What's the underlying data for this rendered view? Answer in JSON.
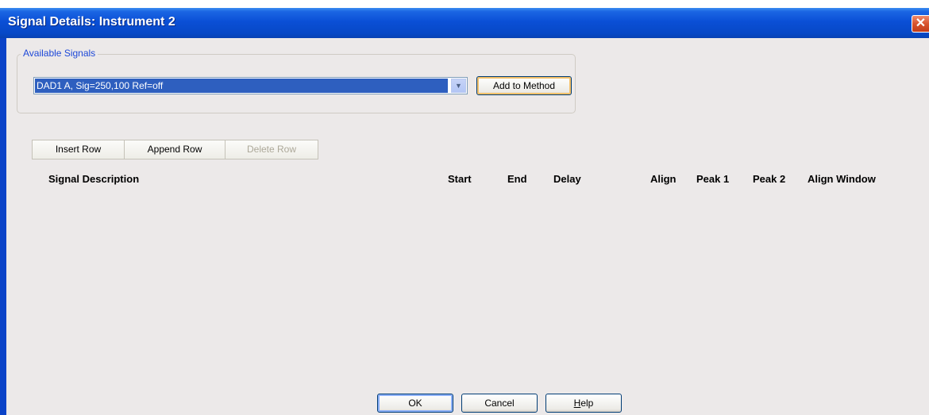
{
  "window": {
    "title": "Signal Details: Instrument 2",
    "close_glyph": "✕"
  },
  "available_signals": {
    "group_label": "Available Signals",
    "selected_signal": "DAD1 A, Sig=250,100 Ref=off",
    "dropdown_icon": "chevron-down-icon",
    "add_button_label": "Add to Method"
  },
  "row_toolbar": {
    "insert_label": "Insert Row",
    "append_label": "Append Row",
    "delete_label": "Delete Row"
  },
  "table": {
    "columns": [
      "Signal Description",
      "Start",
      "End",
      "Delay",
      "Align",
      "Peak 1",
      "Peak 2",
      "Align Window"
    ],
    "rows": []
  },
  "footer": {
    "ok_label": "OK",
    "cancel_label": "Cancel",
    "help_label_prefix": "",
    "help_label_mnemonic": "H",
    "help_label_rest": "elp"
  },
  "colors": {
    "title_bar": "#0a4fd6",
    "dialog_background": "#ece9e9",
    "selection_highlight": "#2e5fbf",
    "group_label_text": "#1d48d8"
  }
}
